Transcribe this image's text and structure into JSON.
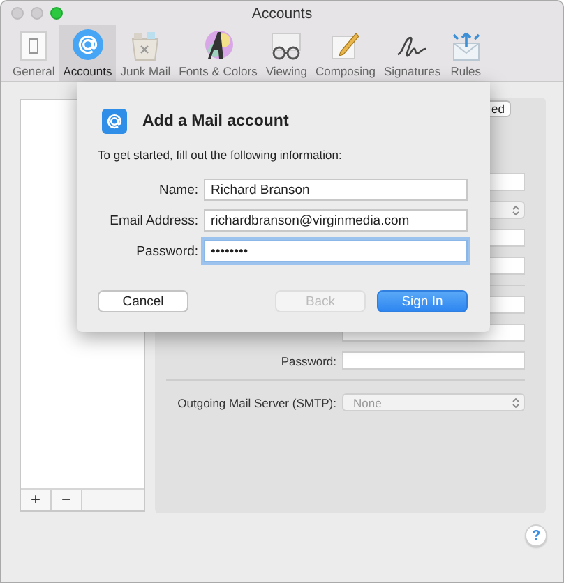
{
  "window": {
    "title": "Accounts"
  },
  "toolbar": [
    {
      "label": "General",
      "kind": "general",
      "selected": false
    },
    {
      "label": "Accounts",
      "kind": "accounts",
      "selected": true
    },
    {
      "label": "Junk Mail",
      "kind": "junk",
      "selected": false
    },
    {
      "label": "Fonts & Colors",
      "kind": "fonts",
      "selected": false
    },
    {
      "label": "Viewing",
      "kind": "viewing",
      "selected": false
    },
    {
      "label": "Composing",
      "kind": "composing",
      "selected": false
    },
    {
      "label": "Signatures",
      "kind": "signatures",
      "selected": false
    },
    {
      "label": "Rules",
      "kind": "rules",
      "selected": false
    }
  ],
  "account_list": {
    "buttons": [
      "+",
      "−"
    ]
  },
  "panel": {
    "tab_button": "ed",
    "password_label": "Password:",
    "smtp_label": "Outgoing Mail Server (SMTP):",
    "smtp_value": "None"
  },
  "help_button": "?",
  "dialog": {
    "title": "Add a Mail account",
    "intro": "To get started, fill out the following information:",
    "fields": [
      {
        "label": "Name:",
        "value": "Richard Branson",
        "focused": false
      },
      {
        "label": "Email Address:",
        "value": "richardbranson@virginmedia.com",
        "focused": false
      },
      {
        "label": "Password:",
        "value": "••••••••",
        "focused": true
      }
    ],
    "buttons": [
      {
        "label": "Cancel",
        "kind": "normal"
      },
      {
        "label": "Back",
        "kind": "disabled"
      },
      {
        "label": "Sign In",
        "kind": "primary"
      }
    ]
  }
}
